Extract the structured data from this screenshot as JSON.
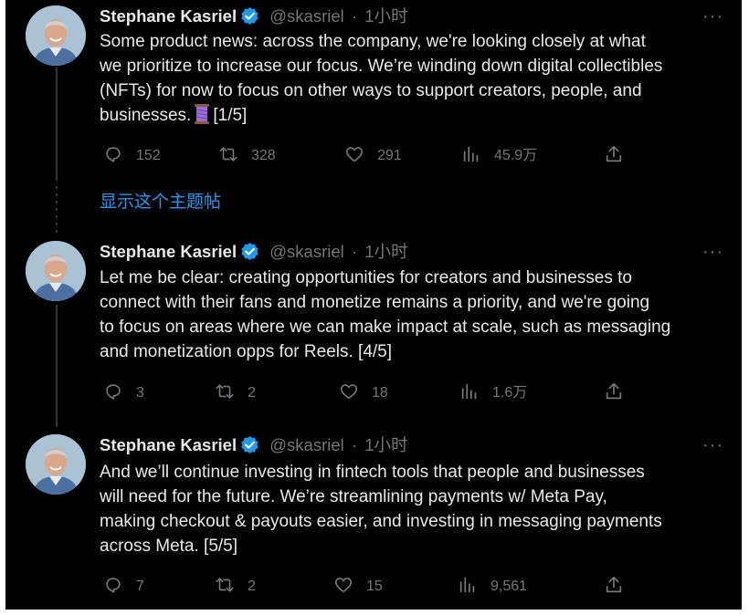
{
  "show_thread_label": "显示这个主题帖",
  "tweets": [
    {
      "author": "Stephane Kasriel",
      "handle": "@skasriel",
      "separator": "·",
      "time": "1小时",
      "more": "···",
      "text_before_emoji": "Some product news: across the company, we're looking closely at what\nwe prioritize to increase our focus. We’re winding down digital collectibles\n(NFTs) for now to focus on other ways to support creators, people, and\nbusinesses.",
      "text_after_emoji": "[1/5]",
      "emoji": "spool-of-thread-emoji",
      "replies": "152",
      "retweets": "328",
      "likes": "291",
      "views": "45.9万"
    },
    {
      "author": "Stephane Kasriel",
      "handle": "@skasriel",
      "separator": "·",
      "time": "1小时",
      "more": "···",
      "text": "Let me be clear: creating opportunities for creators and businesses to\nconnect with their fans and monetize remains a priority, and we're going\nto focus on areas where we can make impact at scale, such as messaging\nand monetization opps for Reels. [4/5]",
      "replies": "3",
      "retweets": "2",
      "likes": "18",
      "views": "1.6万"
    },
    {
      "author": "Stephane Kasriel",
      "handle": "@skasriel",
      "separator": "·",
      "time": "1小时",
      "more": "···",
      "text": "And we’ll continue investing in fintech tools that people and businesses\nwill need for the future. We’re streamlining payments w/ Meta Pay,\nmaking checkout & payouts easier, and investing in messaging payments\nacross Meta. [5/5]",
      "replies": "7",
      "retweets": "2",
      "likes": "15",
      "views": "9,561"
    }
  ],
  "colors": {
    "background": "#000000",
    "primary_text": "#e7e9ea",
    "secondary_text": "#71767b",
    "link": "#1d9bf0",
    "verified": "#1d9bf0"
  },
  "icons": [
    "reply-icon",
    "retweet-icon",
    "like-icon",
    "views-icon",
    "share-icon",
    "verified-badge-icon",
    "more-icon"
  ]
}
